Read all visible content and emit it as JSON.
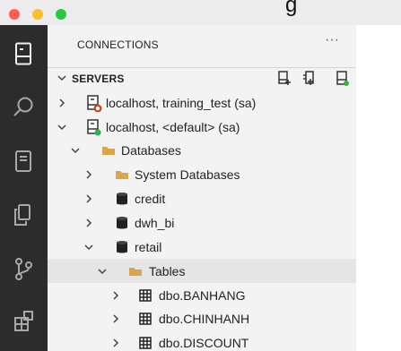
{
  "window": {
    "title_fragment": "g"
  },
  "activity_bar": {
    "icons": [
      "connections-icon",
      "search-icon",
      "notebook-icon",
      "copy-icon",
      "source-control-icon",
      "extensions-icon"
    ]
  },
  "sidebar": {
    "section_title": "CONNECTIONS",
    "more_label": "···",
    "servers_title": "SERVERS",
    "items": [
      {
        "label": "localhost, training_test (sa)",
        "icon": "server-disconnected-icon",
        "state": "collapsed"
      },
      {
        "label": "localhost, <default> (sa)",
        "icon": "server-connected-icon",
        "state": "expanded"
      },
      {
        "label": "Databases",
        "icon": "folder-icon",
        "state": "expanded"
      },
      {
        "label": "System Databases",
        "icon": "folder-icon",
        "state": "collapsed"
      },
      {
        "label": "credit",
        "icon": "database-icon",
        "state": "collapsed"
      },
      {
        "label": "dwh_bi",
        "icon": "database-icon",
        "state": "collapsed"
      },
      {
        "label": "retail",
        "icon": "database-icon",
        "state": "expanded"
      },
      {
        "label": "Tables",
        "icon": "folder-icon",
        "state": "expanded",
        "selected": true
      },
      {
        "label": "dbo.BANHANG",
        "icon": "table-icon",
        "state": "collapsed"
      },
      {
        "label": "dbo.CHINHANH",
        "icon": "table-icon",
        "state": "collapsed"
      },
      {
        "label": "dbo.DISCOUNT",
        "icon": "table-icon",
        "state": "collapsed"
      }
    ]
  },
  "colors": {
    "activity_bar": "#2c2c2c",
    "sidebar": "#f3f3f3",
    "folder": "#d9a54a",
    "connected": "#2fb44f",
    "disconnected": "#c5451a"
  }
}
